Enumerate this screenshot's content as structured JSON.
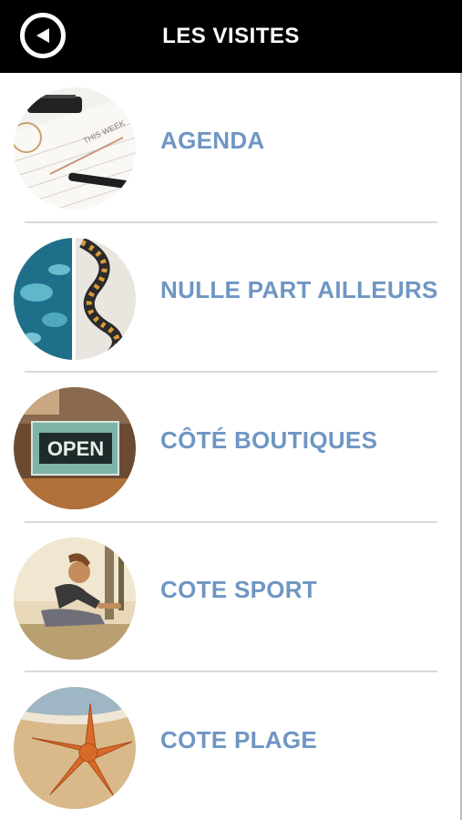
{
  "header": {
    "title": "LES VISITES",
    "back_icon": "chevron-left-circle-icon",
    "background": "#000000",
    "text_color": "#ffffff"
  },
  "accent_color": "#6f96c3",
  "items": [
    {
      "label": "AGENDA",
      "image": "planner-notebook-with-pen"
    },
    {
      "label": "NULLE PART AILLEURS",
      "image": "lagoon-aerial-and-sea-snake"
    },
    {
      "label": "CÔTÉ BOUTIQUES",
      "image": "open-sign-in-shop-window"
    },
    {
      "label": "COTE SPORT",
      "image": "woman-stretching-outdoors"
    },
    {
      "label": "COTE PLAGE",
      "image": "starfish-on-sand"
    }
  ]
}
